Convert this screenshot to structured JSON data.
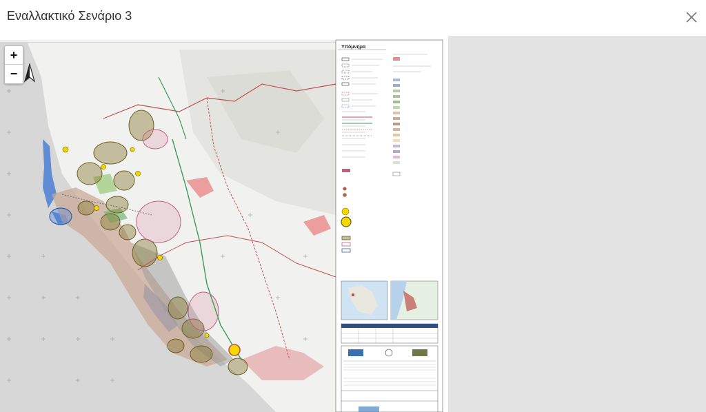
{
  "header": {
    "title": "Εναλλακτικό Σενάριο 3"
  },
  "map": {
    "legend_title": "Υπόμνημα",
    "zoom_in": "+",
    "zoom_out": "−"
  },
  "colors": {
    "sea": "#4a7fd4",
    "urban": "#c98a8a",
    "olive": "#8b7d3a",
    "pink": "#d98aa0",
    "road_red": "#c0504d",
    "road_green": "#3a9a5a"
  }
}
